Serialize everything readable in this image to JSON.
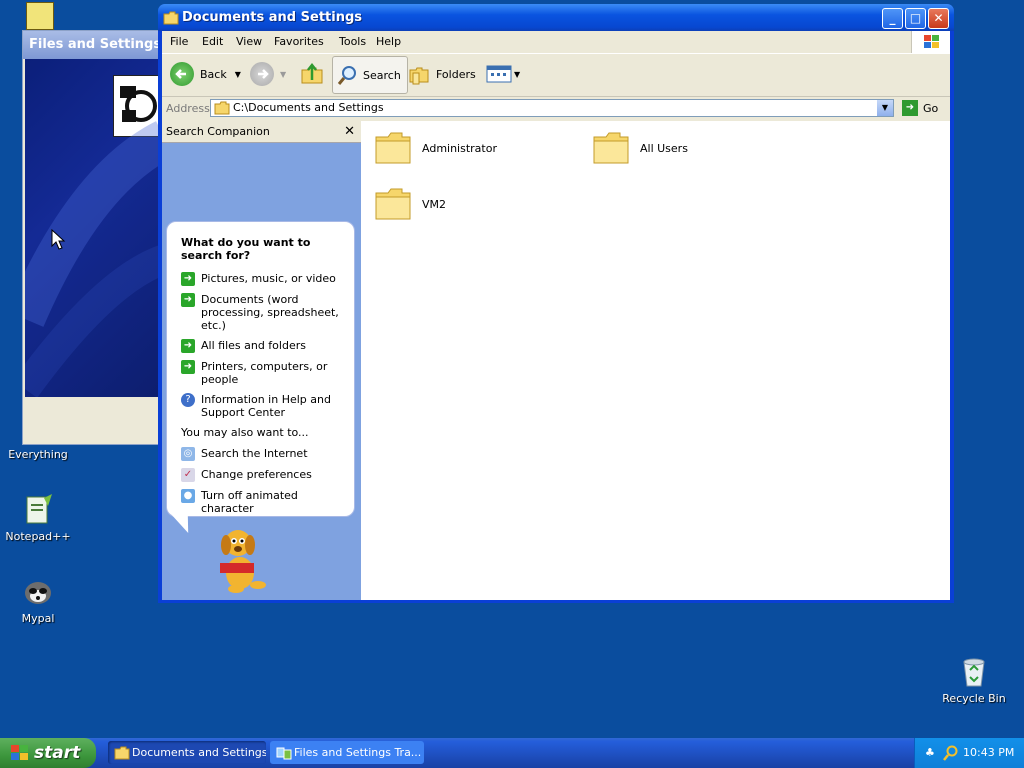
{
  "desktop": {
    "icons": [
      {
        "label": "Everything"
      },
      {
        "label": "Notepad++"
      },
      {
        "label": "Mypal"
      },
      {
        "label": "Recycle Bin"
      }
    ]
  },
  "background_window": {
    "title": "Files and Settings Tr"
  },
  "window": {
    "title": "Documents and Settings",
    "menu": [
      "File",
      "Edit",
      "View",
      "Favorites",
      "Tools",
      "Help"
    ],
    "toolbar": {
      "back": "Back",
      "search": "Search",
      "folders": "Folders"
    },
    "address": {
      "label": "Address",
      "value": "C:\\Documents and Settings",
      "go": "Go"
    }
  },
  "search_pane": {
    "title": "Search Companion",
    "heading": "What do you want to search for?",
    "options": [
      "Pictures, music, or video",
      "Documents (word processing, spreadsheet, etc.)",
      "All files and folders",
      "Printers, computers, or people",
      "Information in Help and Support Center"
    ],
    "also_heading": "You may also want to...",
    "also": [
      "Search the Internet",
      "Change preferences",
      "Turn off animated character"
    ]
  },
  "folders": [
    "Administrator",
    "All Users",
    "VM2"
  ],
  "taskbar": {
    "start": "start",
    "tasks": [
      "Documents and Settings",
      "Files and Settings Tra..."
    ],
    "clock": "10:43 PM"
  },
  "colors": {
    "desktop": "#0a4d9e",
    "titlebar": "#0a54e0",
    "taskbar": "#245edb",
    "start": "#3c963c"
  }
}
